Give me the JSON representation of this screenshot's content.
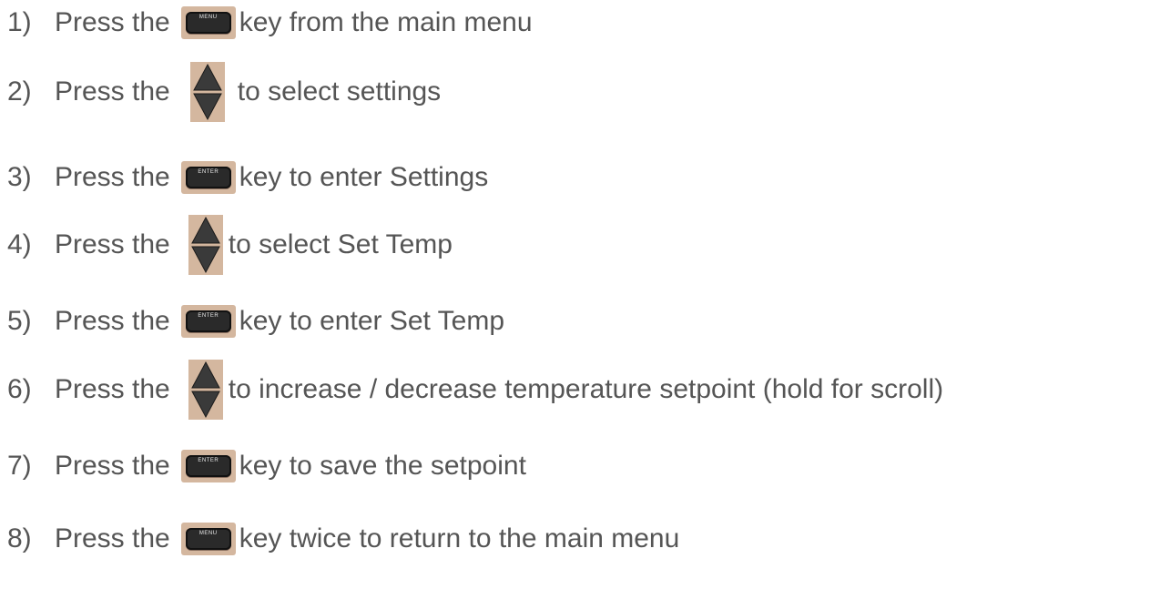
{
  "keys": {
    "menu_label": "MENU",
    "enter_label": "ENTER"
  },
  "steps": [
    {
      "number": "1)",
      "prefix": "Press the",
      "key": "menu",
      "suffix": "key from the main menu"
    },
    {
      "number": "2)",
      "prefix": "Press the",
      "key": "arrows",
      "suffix": "to select settings"
    },
    {
      "number": "3)",
      "prefix": "Press the",
      "key": "enter",
      "suffix": "key to enter Settings"
    },
    {
      "number": "4)",
      "prefix": "Press the",
      "key": "arrows",
      "suffix": "to select Set Temp"
    },
    {
      "number": "5)",
      "prefix": "Press the",
      "key": "enter",
      "suffix": "key to enter Set Temp"
    },
    {
      "number": "6)",
      "prefix": "Press the",
      "key": "arrows",
      "suffix": "to increase / decrease temperature setpoint (hold for scroll)"
    },
    {
      "number": "7)",
      "prefix": "Press the",
      "key": "enter",
      "suffix": "key to save the setpoint"
    },
    {
      "number": "8)",
      "prefix": "Press the",
      "key": "menu",
      "suffix": "key twice to return to the main menu"
    }
  ],
  "colors": {
    "text": "#555555",
    "key_background": "#d4b79f",
    "key_face": "#2a2a2a"
  },
  "icons": {
    "menu": "menu-key-icon",
    "enter": "enter-key-icon",
    "arrows": "up-down-arrow-key-icon"
  }
}
